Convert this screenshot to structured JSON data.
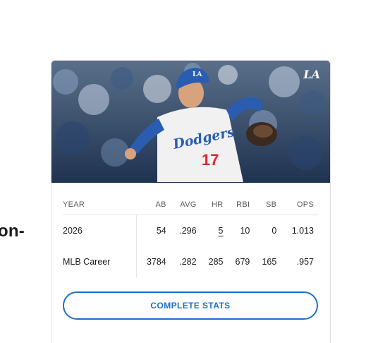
{
  "page": {
    "side_text": "on-"
  },
  "card": {
    "team_logo": "LA",
    "photo_alt": "Dodgers pitcher number 17 throwing",
    "jersey_text": "Dodgers",
    "jersey_number": "17",
    "stats": {
      "columns": [
        "YEAR",
        "AB",
        "AVG",
        "HR",
        "RBI",
        "SB",
        "OPS"
      ],
      "rows": [
        {
          "year": "2026",
          "ab": "54",
          "avg": ".296",
          "hr": "5",
          "rbi": "10",
          "sb": "0",
          "ops": "1.013"
        },
        {
          "year": "MLB Career",
          "ab": "3784",
          "avg": ".282",
          "hr": "285",
          "rbi": "679",
          "sb": "165",
          "ops": ".957"
        }
      ]
    },
    "cta_label": "COMPLETE STATS"
  },
  "colors": {
    "accent": "#1c70c9",
    "dodger_blue": "#2a5db0",
    "jersey_red": "#d42d2d"
  }
}
